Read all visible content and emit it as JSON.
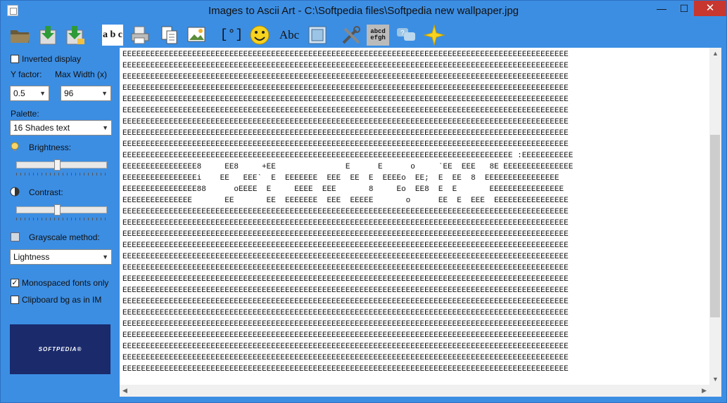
{
  "window": {
    "title": "Images to Ascii Art - C:\\Softpedia files\\Softpedia new wallpaper.jpg",
    "min_label": "—",
    "max_label": "☐",
    "close_label": "✕"
  },
  "toolbar": {
    "icons": [
      "open-folder-icon",
      "save-icon",
      "save-as-icon",
      "text-font-icon",
      "printer-icon",
      "copy-icon",
      "image-icon",
      "face-capture-icon",
      "smiley-icon",
      "abc-text-icon",
      "picture-frame-icon",
      "tools-icon",
      "charset-icon",
      "help-chat-icon",
      "star-icon"
    ],
    "abc_label": "Abc",
    "charset_label": "abcd efgh",
    "fonts_label": "a b c"
  },
  "sidebar": {
    "inverted_display": "Inverted display",
    "y_factor_label": "Y factor:",
    "max_width_label": "Max Width (x)",
    "y_factor_value": "0.5",
    "max_width_value": "96",
    "palette_label": "Palette:",
    "palette_value": "16 Shades text",
    "brightness_label": "Brightness:",
    "brightness_value": 0.45,
    "contrast_label": "Contrast:",
    "contrast_value": 0.45,
    "grayscale_label": "Grayscale method:",
    "grayscale_value": "Lightness",
    "monospaced_label": "Monospaced fonts only",
    "monospaced_checked": "✓",
    "clipboard_label": "Clipboard bg as in IM",
    "logo_text": "SOFTPEDIA®"
  },
  "ascii_output": "EEEEEEEEEEEEEEEEEEEEEEEEEEEEEEEEEEEEEEEEEEEEEEEEEEEEEEEEEEEEEEEEEEEEEEEEEEEEEEEEEEEEEEEEEEEEEEEE\nEEEEEEEEEEEEEEEEEEEEEEEEEEEEEEEEEEEEEEEEEEEEEEEEEEEEEEEEEEEEEEEEEEEEEEEEEEEEEEEEEEEEEEEEEEEEEEEE\nEEEEEEEEEEEEEEEEEEEEEEEEEEEEEEEEEEEEEEEEEEEEEEEEEEEEEEEEEEEEEEEEEEEEEEEEEEEEEEEEEEEEEEEEEEEEEEEE\nEEEEEEEEEEEEEEEEEEEEEEEEEEEEEEEEEEEEEEEEEEEEEEEEEEEEEEEEEEEEEEEEEEEEEEEEEEEEEEEEEEEEEEEEEEEEEEEE\nEEEEEEEEEEEEEEEEEEEEEEEEEEEEEEEEEEEEEEEEEEEEEEEEEEEEEEEEEEEEEEEEEEEEEEEEEEEEEEEEEEEEEEEEEEEEEEEE\nEEEEEEEEEEEEEEEEEEEEEEEEEEEEEEEEEEEEEEEEEEEEEEEEEEEEEEEEEEEEEEEEEEEEEEEEEEEEEEEEEEEEEEEEEEEEEEEE\nEEEEEEEEEEEEEEEEEEEEEEEEEEEEEEEEEEEEEEEEEEEEEEEEEEEEEEEEEEEEEEEEEEEEEEEEEEEEEEEEEEEEEEEEEEEEEEEE\nEEEEEEEEEEEEEEEEEEEEEEEEEEEEEEEEEEEEEEEEEEEEEEEEEEEEEEEEEEEEEEEEEEEEEEEEEEEEEEEEEEEEEEEEEEEEEEEE\nEEEEEEEEEEEEEEEEEEEEEEEEEEEEEEEEEEEEEEEEEEEEEEEEEEEEEEEEEEEEEEEEEEEEEEEEEEEEEEEEEEEEEEEEEEEEEEEE\nEEEEEEEEEEEEEEEEEEEEEEEEEEEEEEEEEEEEEEEEEEEEEEEEEEEEEEEEEEEEEEEEEEEEEEEEEEEEEEEEEEEE :EEEEEEEEEEE\nEEEEEEEEEEEEEEEE8     EE8     +EE               E      E      o     `EE  EEE   8E EEEEEEEEEEEEEEE\nEEEEEEEEEEEEEEEEi    EE   EEE`  E  EEEEEEE  EEE  EE  E  EEEEo  EE;  E  EE  8  EEEEEEEEEEEEEEEE\nEEEEEEEEEEEEEEEE88      oEEEE  E     EEEE  EEE       8     Eo  EE8  E  E       EEEEEEEEEEEEEEEE\nEEEEEEEEEEEEEEE       EE       EE  EEEEEEE  EEE  EEEEE       o      EE  E  EEE  EEEEEEEEEEEEEEEE\nEEEEEEEEEEEEEEEEEEEEEEEEEEEEEEEEEEEEEEEEEEEEEEEEEEEEEEEEEEEEEEEEEEEEEEEEEEEEEEEEEEEEEEEEEEEEEEEE\nEEEEEEEEEEEEEEEEEEEEEEEEEEEEEEEEEEEEEEEEEEEEEEEEEEEEEEEEEEEEEEEEEEEEEEEEEEEEEEEEEEEEEEEEEEEEEEEE\nEEEEEEEEEEEEEEEEEEEEEEEEEEEEEEEEEEEEEEEEEEEEEEEEEEEEEEEEEEEEEEEEEEEEEEEEEEEEEEEEEEEEEEEEEEEEEEEE\nEEEEEEEEEEEEEEEEEEEEEEEEEEEEEEEEEEEEEEEEEEEEEEEEEEEEEEEEEEEEEEEEEEEEEEEEEEEEEEEEEEEEEEEEEEEEEEEE\nEEEEEEEEEEEEEEEEEEEEEEEEEEEEEEEEEEEEEEEEEEEEEEEEEEEEEEEEEEEEEEEEEEEEEEEEEEEEEEEEEEEEEEEEEEEEEEEE\nEEEEEEEEEEEEEEEEEEEEEEEEEEEEEEEEEEEEEEEEEEEEEEEEEEEEEEEEEEEEEEEEEEEEEEEEEEEEEEEEEEEEEEEEEEEEEEEE\nEEEEEEEEEEEEEEEEEEEEEEEEEEEEEEEEEEEEEEEEEEEEEEEEEEEEEEEEEEEEEEEEEEEEEEEEEEEEEEEEEEEEEEEEEEEEEEEE\nEEEEEEEEEEEEEEEEEEEEEEEEEEEEEEEEEEEEEEEEEEEEEEEEEEEEEEEEEEEEEEEEEEEEEEEEEEEEEEEEEEEEEEEEEEEEEEEE\nEEEEEEEEEEEEEEEEEEEEEEEEEEEEEEEEEEEEEEEEEEEEEEEEEEEEEEEEEEEEEEEEEEEEEEEEEEEEEEEEEEEEEEEEEEEEEEEE\nEEEEEEEEEEEEEEEEEEEEEEEEEEEEEEEEEEEEEEEEEEEEEEEEEEEEEEEEEEEEEEEEEEEEEEEEEEEEEEEEEEEEEEEEEEEEEEEE\nEEEEEEEEEEEEEEEEEEEEEEEEEEEEEEEEEEEEEEEEEEEEEEEEEEEEEEEEEEEEEEEEEEEEEEEEEEEEEEEEEEEEEEEEEEEEEEEE\nEEEEEEEEEEEEEEEEEEEEEEEEEEEEEEEEEEEEEEEEEEEEEEEEEEEEEEEEEEEEEEEEEEEEEEEEEEEEEEEEEEEEEEEEEEEEEEEE\nEEEEEEEEEEEEEEEEEEEEEEEEEEEEEEEEEEEEEEEEEEEEEEEEEEEEEEEEEEEEEEEEEEEEEEEEEEEEEEEEEEEEEEEEEEEEEEEE\nEEEEEEEEEEEEEEEEEEEEEEEEEEEEEEEEEEEEEEEEEEEEEEEEEEEEEEEEEEEEEEEEEEEEEEEEEEEEEEEEEEEEEEEEEEEEEEEE\nEEEEEEEEEEEEEEEEEEEEEEEEEEEEEEEEEEEEEEEEEEEEEEEEEEEEEEEEEEEEEEEEEEEEEEEEEEEEEEEEEEEEEEEEEEEEEEEE",
  "colors": {
    "window_blue": "#3c8ee3",
    "close_red": "#c7372f",
    "logo_navy": "#1a2a6b"
  }
}
